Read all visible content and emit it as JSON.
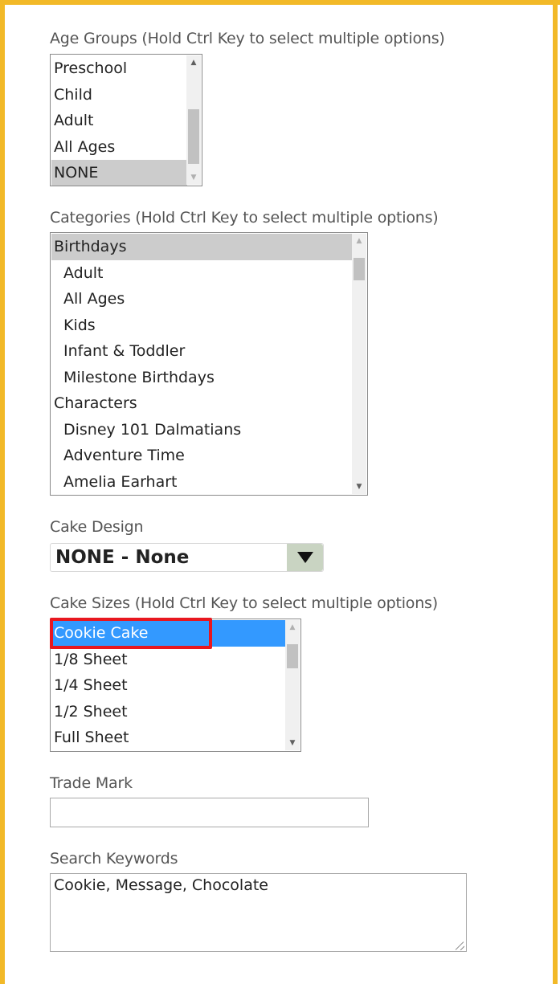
{
  "age_groups": {
    "label": "Age Groups (Hold Ctrl Key to select multiple options)",
    "options": [
      "Preschool",
      "Child",
      "Adult",
      "All Ages",
      "NONE"
    ]
  },
  "categories": {
    "label": "Categories (Hold Ctrl Key to select multiple options)",
    "options": [
      "Birthdays",
      "Adult",
      "All Ages",
      "Kids",
      "Infant & Toddler",
      "Milestone Birthdays",
      "Characters",
      "Disney 101 Dalmatians",
      "Adventure Time",
      "Amelia Earhart"
    ]
  },
  "cake_design": {
    "label": "Cake Design",
    "value": "NONE - None"
  },
  "cake_sizes": {
    "label": "Cake Sizes (Hold Ctrl Key to select multiple options)",
    "options": [
      "Cookie Cake",
      "1/8 Sheet",
      "1/4 Sheet",
      "1/2 Sheet",
      "Full Sheet"
    ]
  },
  "trade_mark": {
    "label": "Trade Mark",
    "value": ""
  },
  "search_keywords": {
    "label": "Search Keywords",
    "value": "Cookie, Message, Chocolate"
  },
  "icons": {
    "scroll_up": "triangle-up-icon",
    "scroll_down": "triangle-down-icon",
    "dropdown": "triangle-down-icon",
    "resize": "resize-grip-icon"
  },
  "colors": {
    "frame": "#F2B928",
    "selected_blue": "#3399FF",
    "selected_grey": "#CCCCCC",
    "highlight_red": "#E8171F"
  }
}
